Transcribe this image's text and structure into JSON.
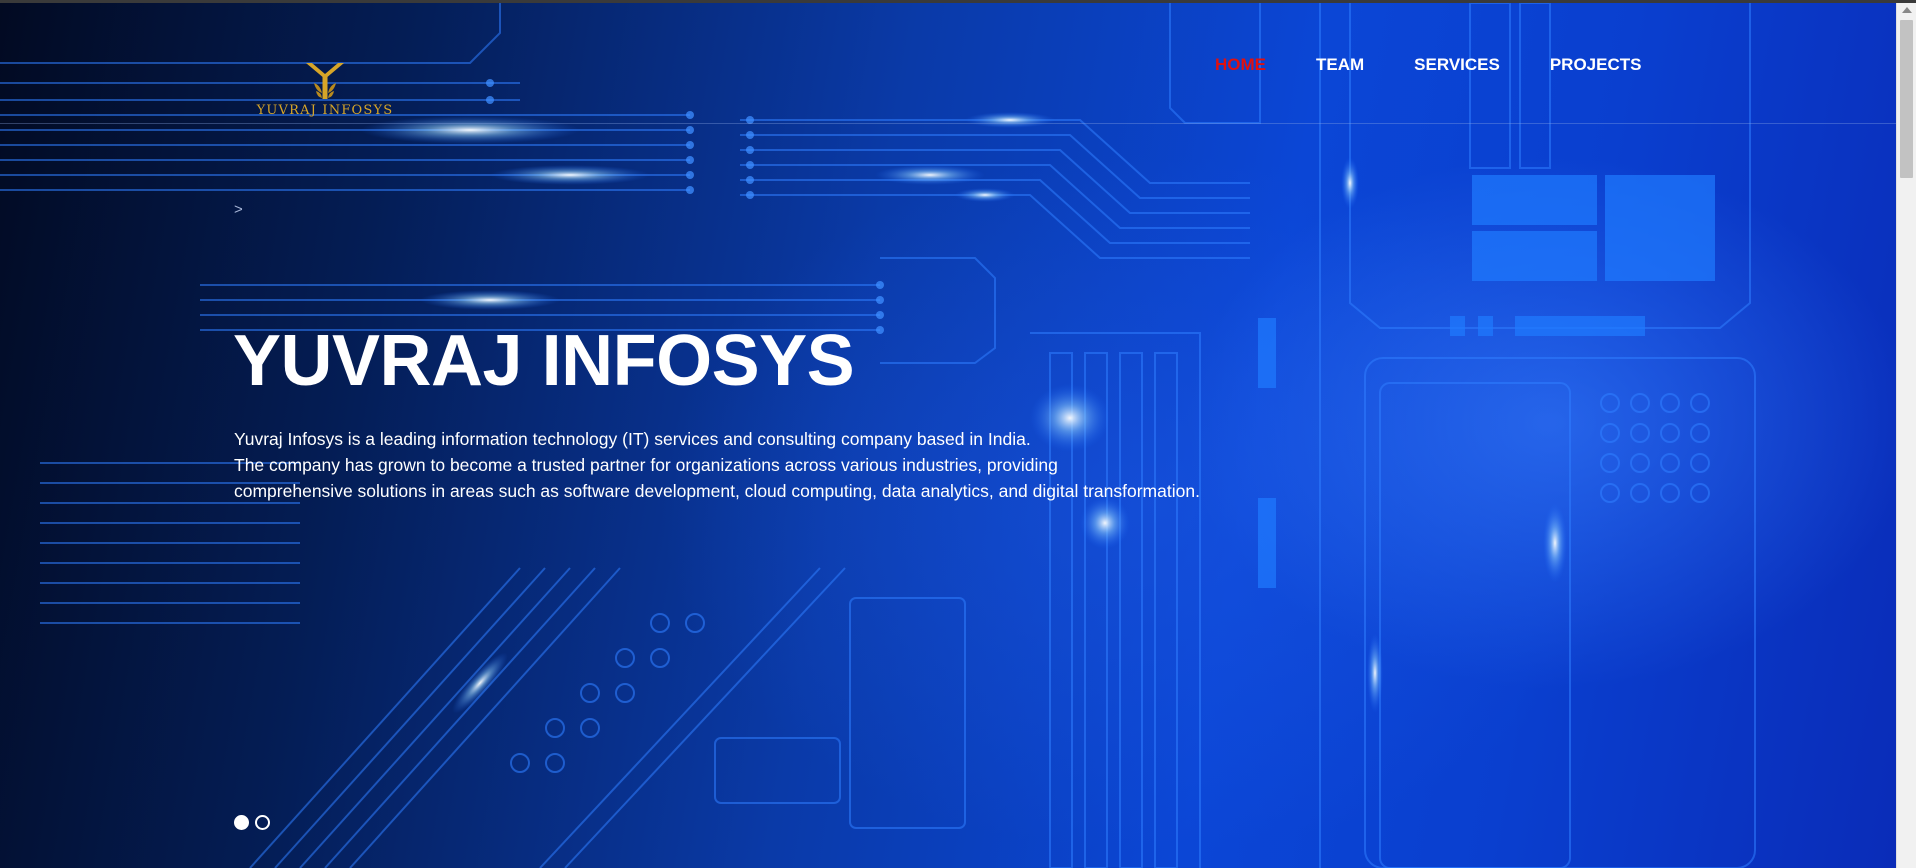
{
  "brand": {
    "name": "YUVRAJ INFOSYS",
    "logo_icon": "y-emblem-icon",
    "logo_color": "#d7a528"
  },
  "nav": {
    "items": [
      {
        "label": "HOME",
        "active": true
      },
      {
        "label": "TEAM",
        "active": false
      },
      {
        "label": "SERVICES",
        "active": false
      },
      {
        "label": "PROJECTS",
        "active": false
      }
    ],
    "active_color": "#e01010"
  },
  "breadcrumb": {
    "separator": ">"
  },
  "hero": {
    "title": "YUVRAJ INFOSYS",
    "description": [
      "Yuvraj Infosys is a leading information technology (IT) services and consulting company based in India.",
      "The company has grown to become a trusted partner for organizations across various industries, providing",
      "comprehensive solutions in areas such as software development, cloud computing, data analytics, and digital transformation."
    ],
    "background": "circuit-board-image"
  },
  "carousel": {
    "slides": 2,
    "active_index": 0
  }
}
